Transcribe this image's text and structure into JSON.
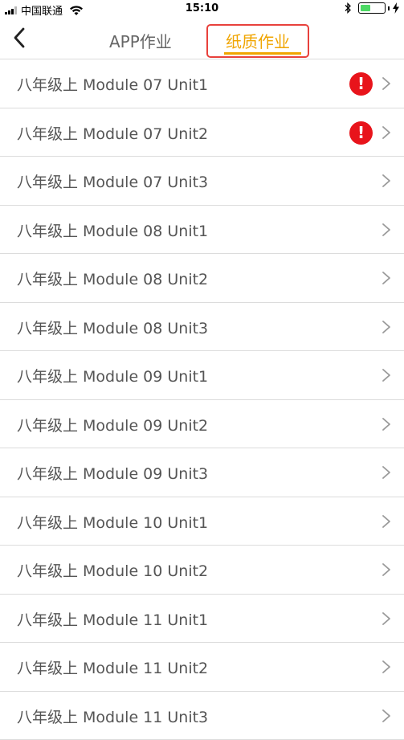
{
  "status_bar": {
    "carrier": "中国联通",
    "time": "15:10"
  },
  "nav": {
    "tab_app": "APP作业",
    "tab_paper": "纸质作业",
    "active_tab": "纸质作业",
    "accent_color": "#f0a500",
    "highlight_color": "#e8413c"
  },
  "list": {
    "items": [
      {
        "title": "八年级上 Module 07 Unit1",
        "alert": true
      },
      {
        "title": "八年级上 Module 07 Unit2",
        "alert": true
      },
      {
        "title": "八年级上 Module 07 Unit3",
        "alert": false
      },
      {
        "title": "八年级上 Module 08 Unit1",
        "alert": false
      },
      {
        "title": "八年级上 Module 08 Unit2",
        "alert": false
      },
      {
        "title": "八年级上 Module 08 Unit3",
        "alert": false
      },
      {
        "title": "八年级上 Module 09 Unit1",
        "alert": false
      },
      {
        "title": "八年级上 Module 09 Unit2",
        "alert": false
      },
      {
        "title": "八年级上 Module 09 Unit3",
        "alert": false
      },
      {
        "title": "八年级上 Module 10 Unit1",
        "alert": false
      },
      {
        "title": "八年级上 Module 10 Unit2",
        "alert": false
      },
      {
        "title": "八年级上 Module 11 Unit1",
        "alert": false
      },
      {
        "title": "八年级上 Module 11 Unit2",
        "alert": false
      },
      {
        "title": "八年级上 Module 11 Unit3",
        "alert": false
      }
    ]
  }
}
